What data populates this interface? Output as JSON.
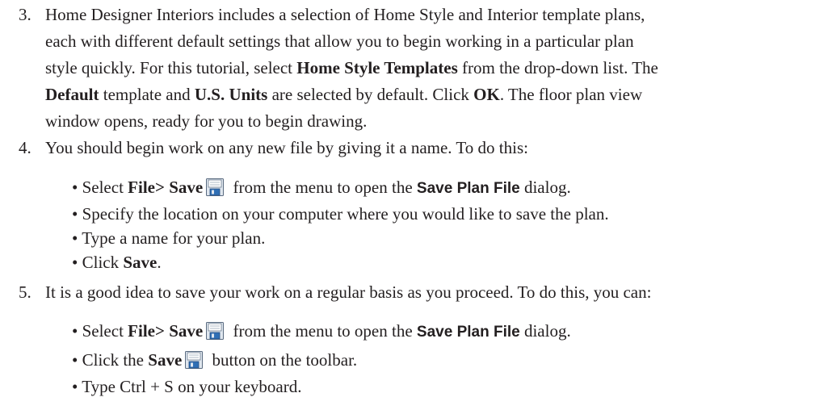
{
  "step3": {
    "number": "3.",
    "l1": "Home Designer Interiors includes a selection of Home Style and Interior template plans,",
    "l2": "each with different default settings that allow you to begin working in a particular plan",
    "l3_pre": "style quickly. For this tutorial, select ",
    "l3_bold": "Home Style Templates",
    "l3_post": " from the drop-down list. The",
    "l4_bold1": "Default",
    "l4_mid1": " template and ",
    "l4_bold2": "U.S. Units",
    "l4_mid2": " are selected by default. Click ",
    "l4_bold3": "OK",
    "l4_post": ". The floor plan view",
    "l5": "window opens, ready for you to begin drawing."
  },
  "step4": {
    "number": "4.",
    "intro": "You should begin work on any new file by giving it a name. To do this:",
    "b1_pre": "• Select ",
    "b1_bold": "File> Save",
    "b1_mid": " from the menu to open the ",
    "b1_dialog": "Save Plan File",
    "b1_post": " dialog.",
    "b2": "• Specify the location on your computer where you would like to save the plan.",
    "b3": "• Type a name for your plan.",
    "b4_pre": "• Click ",
    "b4_bold": "Save",
    "b4_post": "."
  },
  "step5": {
    "number": "5.",
    "intro": "It is a good idea to save your work on a regular basis as you proceed. To do this, you can:",
    "b1_pre": "• Select ",
    "b1_bold": "File> Save",
    "b1_mid": " from the menu to open the ",
    "b1_dialog": "Save Plan File",
    "b1_post": " dialog.",
    "b2_pre": "• Click the ",
    "b2_bold": "Save",
    "b2_post": " button on the toolbar.",
    "b3": "• Type Ctrl + S on your keyboard."
  },
  "icons": {
    "save": "save-floppy-icon"
  }
}
